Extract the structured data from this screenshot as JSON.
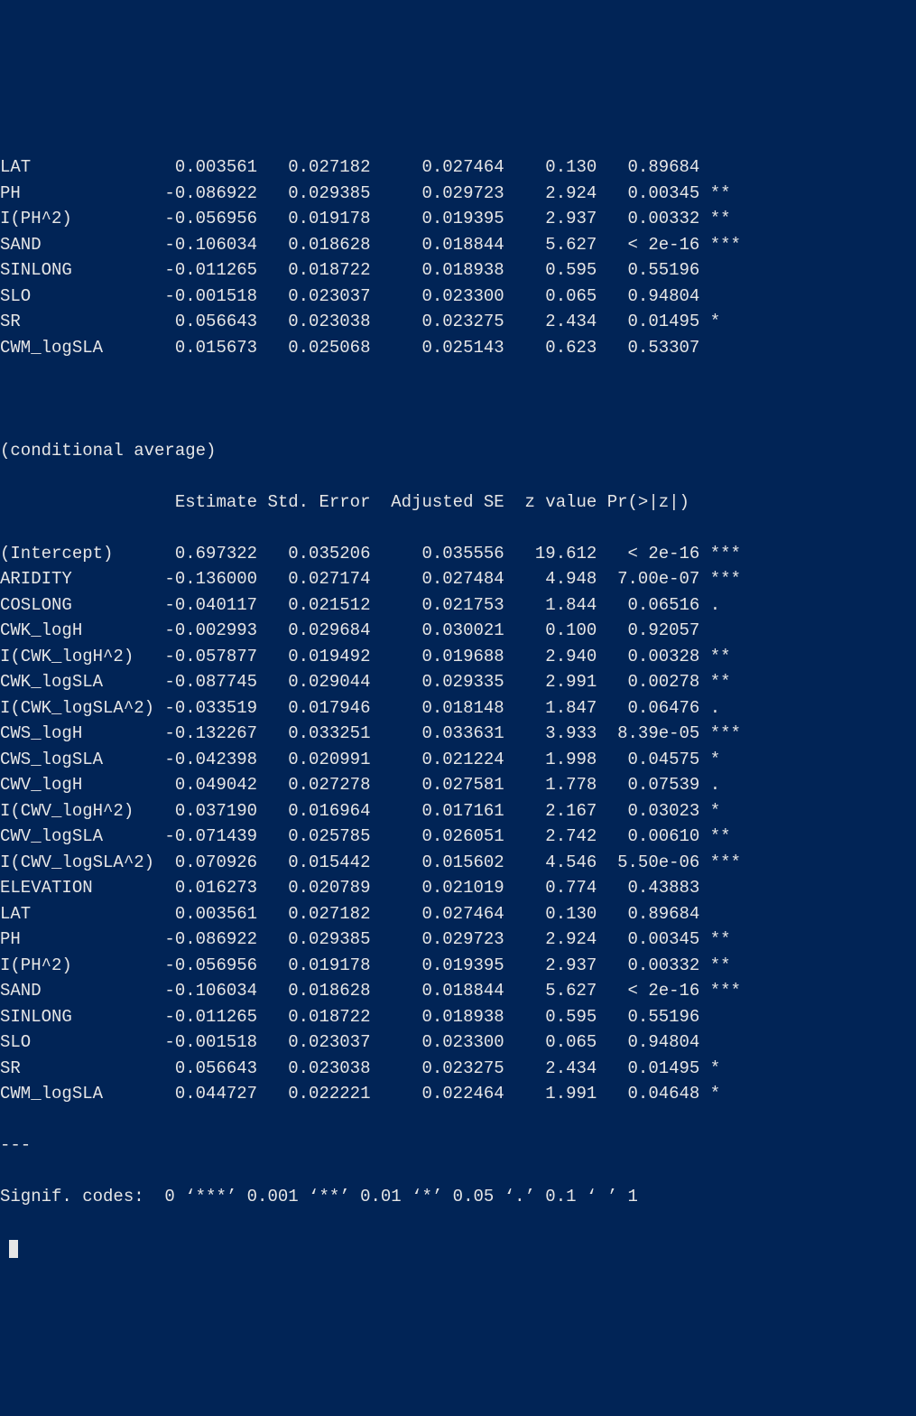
{
  "table1": {
    "rows": [
      {
        "name": "LAT",
        "est": "0.003561",
        "se": "0.027182",
        "ase": "0.027464",
        "z": "0.130",
        "p": "0.89684",
        "sig": ""
      },
      {
        "name": "PH",
        "est": "-0.086922",
        "se": "0.029385",
        "ase": "0.029723",
        "z": "2.924",
        "p": "0.00345",
        "sig": "**"
      },
      {
        "name": "I(PH^2)",
        "est": "-0.056956",
        "se": "0.019178",
        "ase": "0.019395",
        "z": "2.937",
        "p": "0.00332",
        "sig": "**"
      },
      {
        "name": "SAND",
        "est": "-0.106034",
        "se": "0.018628",
        "ase": "0.018844",
        "z": "5.627",
        "p": "< 2e-16",
        "sig": "***"
      },
      {
        "name": "SINLONG",
        "est": "-0.011265",
        "se": "0.018722",
        "ase": "0.018938",
        "z": "0.595",
        "p": "0.55196",
        "sig": ""
      },
      {
        "name": "SLO",
        "est": "-0.001518",
        "se": "0.023037",
        "ase": "0.023300",
        "z": "0.065",
        "p": "0.94804",
        "sig": ""
      },
      {
        "name": "SR",
        "est": "0.056643",
        "se": "0.023038",
        "ase": "0.023275",
        "z": "2.434",
        "p": "0.01495",
        "sig": "*"
      },
      {
        "name": "CWM_logSLA",
        "est": "0.015673",
        "se": "0.025068",
        "ase": "0.025143",
        "z": "0.623",
        "p": "0.53307",
        "sig": ""
      }
    ]
  },
  "section2_title": "(conditional average)",
  "headers": [
    "Estimate",
    "Std. Error",
    "Adjusted SE",
    "z value",
    "Pr(>|z|)"
  ],
  "table2": {
    "rows": [
      {
        "name": "(Intercept)",
        "est": "0.697322",
        "se": "0.035206",
        "ase": "0.035556",
        "z": "19.612",
        "p": "< 2e-16",
        "sig": "***"
      },
      {
        "name": "ARIDITY",
        "est": "-0.136000",
        "se": "0.027174",
        "ase": "0.027484",
        "z": "4.948",
        "p": "7.00e-07",
        "sig": "***"
      },
      {
        "name": "COSLONG",
        "est": "-0.040117",
        "se": "0.021512",
        "ase": "0.021753",
        "z": "1.844",
        "p": "0.06516",
        "sig": "."
      },
      {
        "name": "CWK_logH",
        "est": "-0.002993",
        "se": "0.029684",
        "ase": "0.030021",
        "z": "0.100",
        "p": "0.92057",
        "sig": ""
      },
      {
        "name": "I(CWK_logH^2)",
        "est": "-0.057877",
        "se": "0.019492",
        "ase": "0.019688",
        "z": "2.940",
        "p": "0.00328",
        "sig": "**"
      },
      {
        "name": "CWK_logSLA",
        "est": "-0.087745",
        "se": "0.029044",
        "ase": "0.029335",
        "z": "2.991",
        "p": "0.00278",
        "sig": "**"
      },
      {
        "name": "I(CWK_logSLA^2)",
        "est": "-0.033519",
        "se": "0.017946",
        "ase": "0.018148",
        "z": "1.847",
        "p": "0.06476",
        "sig": "."
      },
      {
        "name": "CWS_logH",
        "est": "-0.132267",
        "se": "0.033251",
        "ase": "0.033631",
        "z": "3.933",
        "p": "8.39e-05",
        "sig": "***"
      },
      {
        "name": "CWS_logSLA",
        "est": "-0.042398",
        "se": "0.020991",
        "ase": "0.021224",
        "z": "1.998",
        "p": "0.04575",
        "sig": "*"
      },
      {
        "name": "CWV_logH",
        "est": "0.049042",
        "se": "0.027278",
        "ase": "0.027581",
        "z": "1.778",
        "p": "0.07539",
        "sig": "."
      },
      {
        "name": "I(CWV_logH^2)",
        "est": "0.037190",
        "se": "0.016964",
        "ase": "0.017161",
        "z": "2.167",
        "p": "0.03023",
        "sig": "*"
      },
      {
        "name": "CWV_logSLA",
        "est": "-0.071439",
        "se": "0.025785",
        "ase": "0.026051",
        "z": "2.742",
        "p": "0.00610",
        "sig": "**"
      },
      {
        "name": "I(CWV_logSLA^2)",
        "est": "0.070926",
        "se": "0.015442",
        "ase": "0.015602",
        "z": "4.546",
        "p": "5.50e-06",
        "sig": "***"
      },
      {
        "name": "ELEVATION",
        "est": "0.016273",
        "se": "0.020789",
        "ase": "0.021019",
        "z": "0.774",
        "p": "0.43883",
        "sig": ""
      },
      {
        "name": "LAT",
        "est": "0.003561",
        "se": "0.027182",
        "ase": "0.027464",
        "z": "0.130",
        "p": "0.89684",
        "sig": ""
      },
      {
        "name": "PH",
        "est": "-0.086922",
        "se": "0.029385",
        "ase": "0.029723",
        "z": "2.924",
        "p": "0.00345",
        "sig": "**"
      },
      {
        "name": "I(PH^2)",
        "est": "-0.056956",
        "se": "0.019178",
        "ase": "0.019395",
        "z": "2.937",
        "p": "0.00332",
        "sig": "**"
      },
      {
        "name": "SAND",
        "est": "-0.106034",
        "se": "0.018628",
        "ase": "0.018844",
        "z": "5.627",
        "p": "< 2e-16",
        "sig": "***"
      },
      {
        "name": "SINLONG",
        "est": "-0.011265",
        "se": "0.018722",
        "ase": "0.018938",
        "z": "0.595",
        "p": "0.55196",
        "sig": ""
      },
      {
        "name": "SLO",
        "est": "-0.001518",
        "se": "0.023037",
        "ase": "0.023300",
        "z": "0.065",
        "p": "0.94804",
        "sig": ""
      },
      {
        "name": "SR",
        "est": "0.056643",
        "se": "0.023038",
        "ase": "0.023275",
        "z": "2.434",
        "p": "0.01495",
        "sig": "*"
      },
      {
        "name": "CWM_logSLA",
        "est": "0.044727",
        "se": "0.022221",
        "ase": "0.022464",
        "z": "1.991",
        "p": "0.04648",
        "sig": "*"
      }
    ]
  },
  "sep": "---",
  "signif": "Signif. codes:  0 ‘***’ 0.001 ‘**’ 0.01 ‘*’ 0.05 ‘.’ 0.1 ‘ ’ 1"
}
